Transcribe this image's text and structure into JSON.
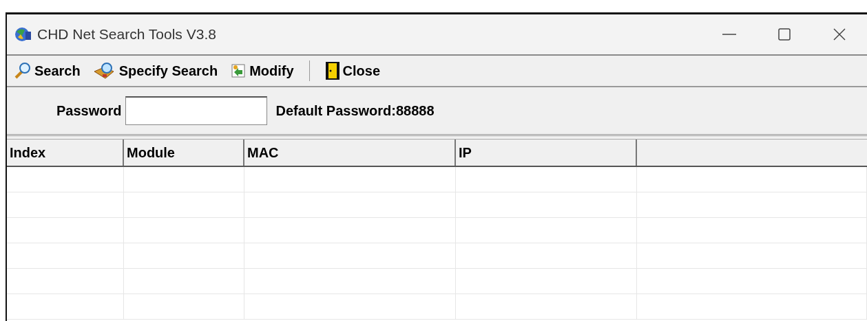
{
  "window": {
    "title": "CHD Net Search Tools V3.8"
  },
  "toolbar": [
    {
      "kind": "search",
      "label": "Search"
    },
    {
      "kind": "specify",
      "label": "Specify Search"
    },
    {
      "kind": "modify",
      "label": "Modify"
    },
    {
      "kind": "close",
      "label": "Close"
    }
  ],
  "password": {
    "label": "Password",
    "hint": "Default Password:88888"
  },
  "table": {
    "columns": [
      "Index",
      "Module",
      "MAC",
      "IP",
      ""
    ]
  }
}
